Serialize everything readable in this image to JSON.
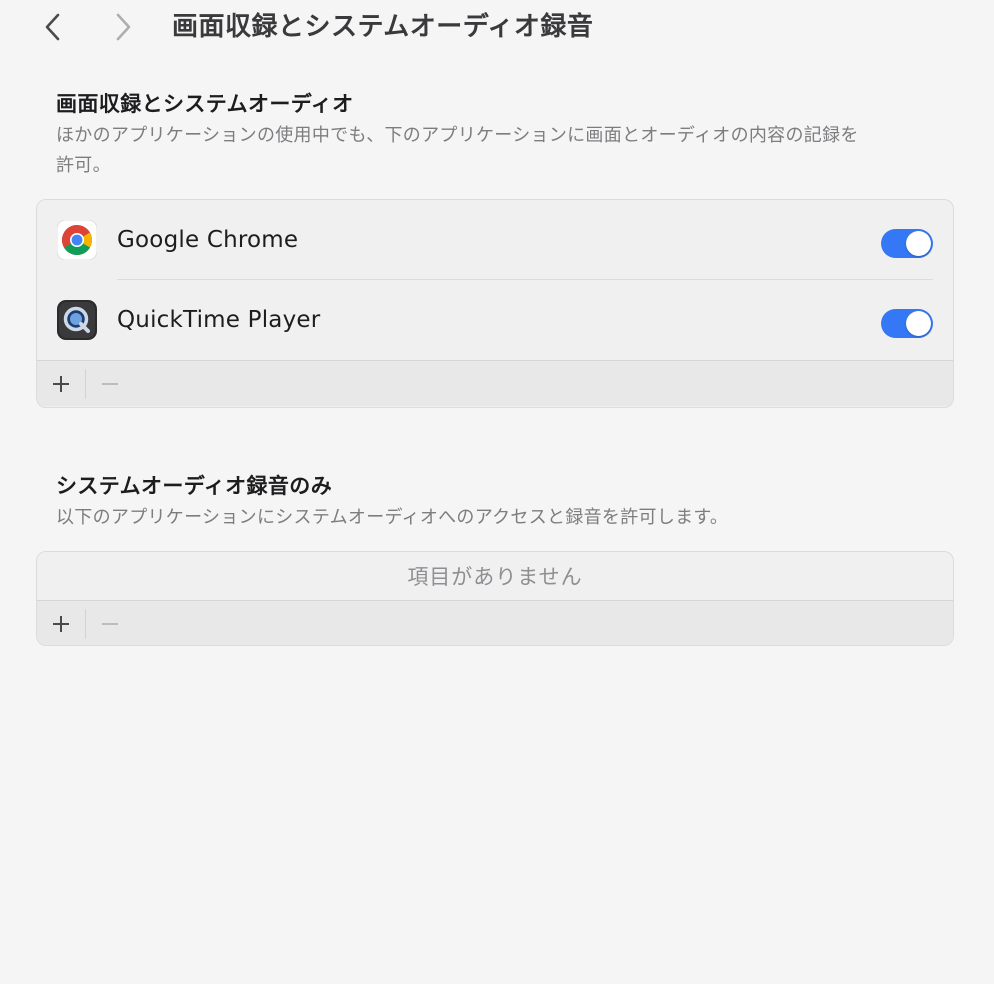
{
  "header": {
    "title": "画面収録とシステムオーディオ録音",
    "back_icon": "chevron-left-icon",
    "forward_icon": "chevron-right-icon"
  },
  "screen_and_audio": {
    "title": "画面収録とシステムオーディオ",
    "description": "ほかのアプリケーションの使用中でも、下のアプリケーションに画面とオーディオの内容の記録を許可。",
    "apps": [
      {
        "name": "Google Chrome",
        "icon": "chrome-icon",
        "enabled": true
      },
      {
        "name": "QuickTime Player",
        "icon": "quicktime-icon",
        "enabled": true
      }
    ],
    "add_icon": "plus-icon",
    "remove_icon": "minus-icon"
  },
  "system_audio_only": {
    "title": "システムオーディオ録音のみ",
    "description": "以下のアプリケーションにシステムオーディオへのアクセスと録音を許可します。",
    "empty_text": "項目がありません",
    "add_icon": "plus-icon",
    "remove_icon": "minus-icon"
  },
  "colors": {
    "toggle_on": "#3478f6",
    "background": "#f5f5f5"
  }
}
